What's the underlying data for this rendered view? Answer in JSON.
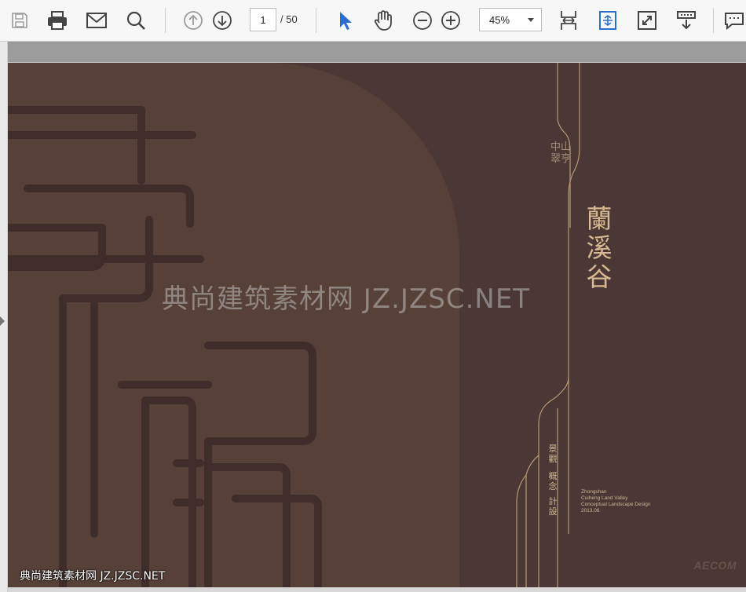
{
  "toolbar": {
    "page": {
      "current": "1",
      "total": "/ 50"
    },
    "zoom": {
      "value": "45%"
    },
    "icons": [
      "save-icon",
      "print-icon",
      "email-icon",
      "search-icon",
      "prev-page-icon",
      "next-page-icon",
      "select-cursor-icon",
      "hand-tool-icon",
      "zoom-out-icon",
      "zoom-in-icon",
      "fit-width-icon",
      "rotate-fit-icon",
      "fullscreen-icon",
      "read-mode-icon",
      "comment-icon"
    ]
  },
  "document": {
    "project_title": "蘭溪谷",
    "location": "中山 翠亨",
    "category_cols": [
      "景觀",
      "概念",
      "計設"
    ],
    "english_lines": [
      "Zhongshan",
      "Cuiheng Land Valley",
      "Conceptual Landscape Design",
      "2013.06"
    ],
    "brand": "AECOM"
  },
  "watermark": {
    "center": "典尚建筑素材网 JZ.JZSC.NET",
    "corner": "典尚建筑素材网 JZ.JZSC.NET"
  },
  "colors": {
    "page_bg": "#4b3836",
    "panel": "#574038",
    "gold": "#d8b98f",
    "accent_blue": "#2a6fc9"
  }
}
